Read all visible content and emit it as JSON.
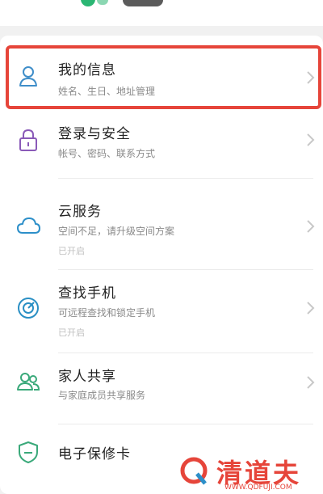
{
  "items": [
    {
      "title": "我的信息",
      "subtitle": "姓名、生日、地址管理",
      "icon": "person-icon",
      "highlighted": true
    },
    {
      "title": "登录与安全",
      "subtitle": "帐号、密码、联系方式",
      "icon": "lock-icon"
    },
    {
      "title": "云服务",
      "subtitle": "空间不足，请升级空间方案",
      "status": "已开启",
      "icon": "cloud-icon"
    },
    {
      "title": "查找手机",
      "subtitle": "可远程查找和锁定手机",
      "status": "已开启",
      "icon": "find-phone-icon"
    },
    {
      "title": "家人共享",
      "subtitle": "与家庭成员共享服务",
      "icon": "family-icon"
    },
    {
      "title": "电子保修卡",
      "icon": "warranty-shield-icon"
    }
  ],
  "watermark": {
    "text": "清道夫",
    "url": "WWW.QDFUJI.COM"
  },
  "colors": {
    "accent": "#2bb673",
    "highlight": "#e6453a"
  }
}
